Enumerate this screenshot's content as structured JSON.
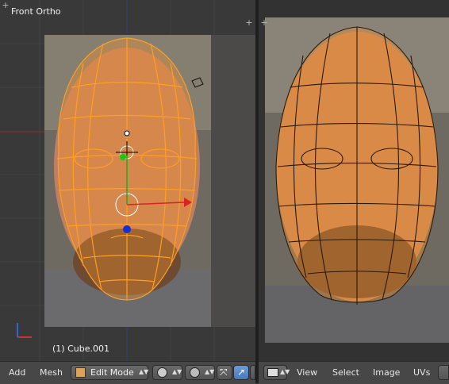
{
  "viewport3d": {
    "title": "Front Ortho",
    "status": "(1) Cube.001"
  },
  "header_left": {
    "add_label": "Add",
    "mesh_label": "Mesh",
    "mode_label": "Edit Mode"
  },
  "header_right": {
    "view_label": "View",
    "select_label": "Select",
    "image_label": "Image",
    "uvs_label": "UVs"
  },
  "icons": [
    "mode-cube-icon",
    "shading-sphere-icon",
    "pivot-icon",
    "transform-manipulator-icon",
    "translate-arrow-icon",
    "editor-type-icon",
    "plus-icon",
    "axis-icon"
  ],
  "colors": {
    "mesh_orange": "#ff9f22",
    "selected_blue": "#5b8fd6",
    "bg_dark": "#393939"
  }
}
